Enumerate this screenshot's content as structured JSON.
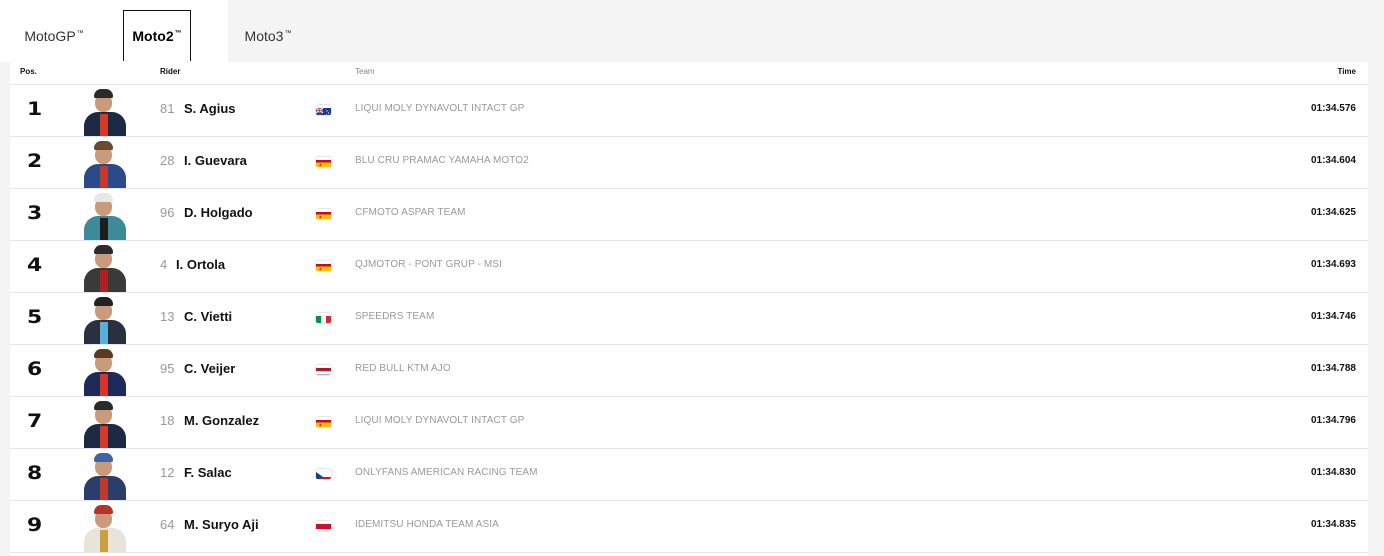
{
  "tabs": [
    {
      "label": "MotoGP",
      "tm": "™"
    },
    {
      "label": "Moto2",
      "tm": "™"
    },
    {
      "label": "Moto3",
      "tm": "™"
    }
  ],
  "headers": {
    "pos": "Pos.",
    "rider": "Rider",
    "team": "Team",
    "time": "Time"
  },
  "rows": [
    {
      "pos": "1",
      "number": "81",
      "rider": "S. Agius",
      "flag": "australia-flag-icon",
      "team": "LIQUI MOLY DYNAVOLT INTACT GP",
      "time": "01:34.576"
    },
    {
      "pos": "2",
      "number": "28",
      "rider": "I. Guevara",
      "flag": "spain-flag-icon",
      "team": "BLU CRU PRAMAC YAMAHA MOTO2",
      "time": "01:34.604"
    },
    {
      "pos": "3",
      "number": "96",
      "rider": "D. Holgado",
      "flag": "spain-flag-icon",
      "team": "CFMOTO ASPAR TEAM",
      "time": "01:34.625"
    },
    {
      "pos": "4",
      "number": "4",
      "rider": "I. Ortola",
      "flag": "spain-flag-icon",
      "team": "QJMOTOR - PONT GRUP - MSI",
      "time": "01:34.693"
    },
    {
      "pos": "5",
      "number": "13",
      "rider": "C. Vietti",
      "flag": "italy-flag-icon",
      "team": "SPEEDRS TEAM",
      "time": "01:34.746"
    },
    {
      "pos": "6",
      "number": "95",
      "rider": "C. Veijer",
      "flag": "netherlands-flag-icon",
      "team": "RED BULL KTM AJO",
      "time": "01:34.788"
    },
    {
      "pos": "7",
      "number": "18",
      "rider": "M. Gonzalez",
      "flag": "spain-flag-icon",
      "team": "LIQUI MOLY DYNAVOLT INTACT GP",
      "time": "01:34.796"
    },
    {
      "pos": "8",
      "number": "12",
      "rider": "F. Salac",
      "flag": "czech-flag-icon",
      "team": "ONLYFANS AMERICAN RACING TEAM",
      "time": "01:34.830"
    },
    {
      "pos": "9",
      "number": "64",
      "rider": "M. Suryo Aji",
      "flag": "indonesia-flag-icon",
      "team": "IDEMITSU HONDA TEAM ASIA",
      "time": "01:34.835"
    }
  ]
}
